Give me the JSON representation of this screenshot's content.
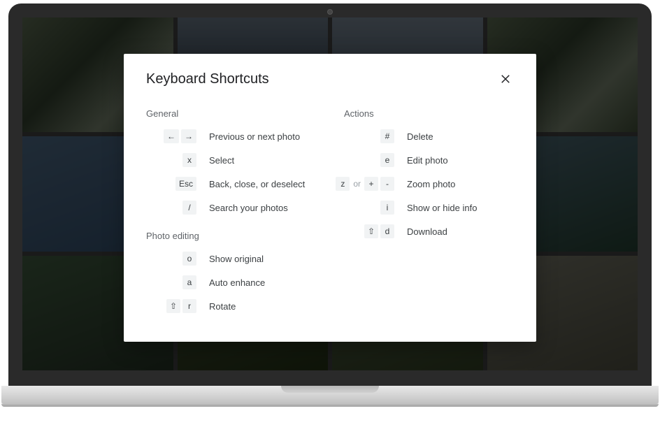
{
  "dialog": {
    "title": "Keyboard Shortcuts",
    "sections": {
      "general": {
        "heading": "General",
        "rows": [
          {
            "keys": [
              "←",
              "→"
            ],
            "desc": "Previous or next photo"
          },
          {
            "keys": [
              "x"
            ],
            "desc": "Select"
          },
          {
            "keys": [
              "Esc"
            ],
            "desc": "Back, close, or deselect"
          },
          {
            "keys": [
              "/"
            ],
            "desc": "Search your photos"
          }
        ]
      },
      "photo_editing": {
        "heading": "Photo editing",
        "rows": [
          {
            "keys": [
              "o"
            ],
            "desc": "Show original"
          },
          {
            "keys": [
              "a"
            ],
            "desc": "Auto enhance"
          },
          {
            "keys": [
              "⇧",
              "r"
            ],
            "desc": "Rotate"
          }
        ]
      },
      "actions": {
        "heading": "Actions",
        "rows": [
          {
            "keys": [
              "#"
            ],
            "desc": "Delete"
          },
          {
            "keys": [
              "e"
            ],
            "desc": "Edit photo"
          },
          {
            "keys": [
              "z",
              "or",
              "+",
              "-"
            ],
            "sep_indices": [
              1
            ],
            "desc": "Zoom photo"
          },
          {
            "keys": [
              "i"
            ],
            "desc": "Show or hide info"
          },
          {
            "keys": [
              "⇧",
              "d"
            ],
            "desc": "Download"
          }
        ]
      }
    }
  }
}
